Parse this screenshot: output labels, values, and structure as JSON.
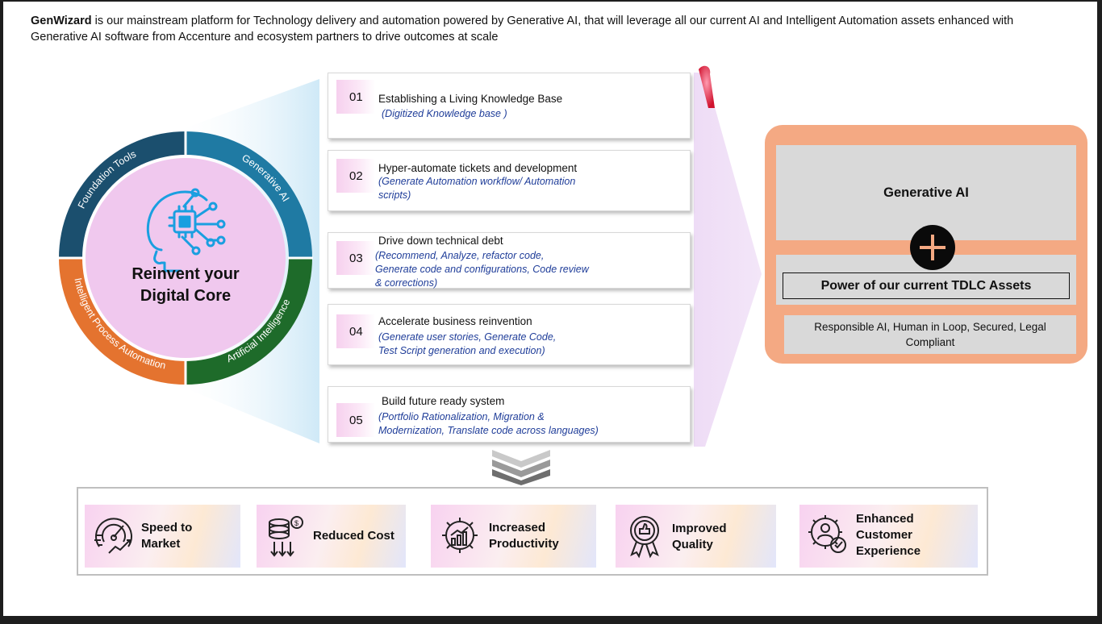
{
  "intro": {
    "brand": "GenWizard",
    "text": " is our mainstream platform for Technology delivery and automation powered by Generative AI, that will leverage all our current AI and Intelligent Automation assets enhanced with Generative AI software from Accenture and ecosystem partners to drive outcomes at scale"
  },
  "wheel": {
    "center_text": [
      "Reinvent your",
      "Digital Core"
    ],
    "segments": [
      "Foundation Tools",
      "Generative AI",
      "Artificial Intelligence",
      "Intelligent Process Automation"
    ],
    "colors": {
      "foundation": "#1b4f6e",
      "generative": "#1f7aa3",
      "ai": "#1e6b2a",
      "ipa": "#e4732f",
      "center": "#f0c8ee"
    }
  },
  "steps": [
    {
      "num": "01",
      "title": "Establishing a Living Knowledge Base",
      "sub": "(Digitized Knowledge base )"
    },
    {
      "num": "02",
      "title": "Hyper-automate tickets and development",
      "sub": "(Generate Automation workflow/ Automation\nscripts)"
    },
    {
      "num": "03",
      "title": "Drive down technical debt",
      "sub": "(Recommend, Analyze, refactor code,\nGenerate code and configurations, Code review\n& corrections)"
    },
    {
      "num": "04",
      "title": "Accelerate business reinvention",
      "sub": "(Generate user stories, Generate Code,\nTest Script generation and execution)"
    },
    {
      "num": "05",
      "title": "Build future ready system",
      "sub": "(Portfolio Rationalization, Migration &\nModernization, Translate code across languages)"
    }
  ],
  "assets": {
    "generative_ai": "Generative AI",
    "tdlc": "Power of our current TDLC Assets",
    "responsible": "Responsible AI, Human in Loop, Secured, Legal Compliant",
    "colors": {
      "frame": "#f4a983",
      "panel": "#d9d9d9"
    }
  },
  "outcomes": [
    {
      "label": "Speed to\nMarket",
      "icon": "speedometer-icon"
    },
    {
      "label": "Reduced Cost",
      "icon": "coins-down-icon"
    },
    {
      "label": "Increased\nProductivity",
      "icon": "gear-chart-icon"
    },
    {
      "label": "Improved\nQuality",
      "icon": "quality-badge-icon"
    },
    {
      "label": "Enhanced\nCustomer\nExperience",
      "icon": "customer-gear-icon"
    }
  ]
}
